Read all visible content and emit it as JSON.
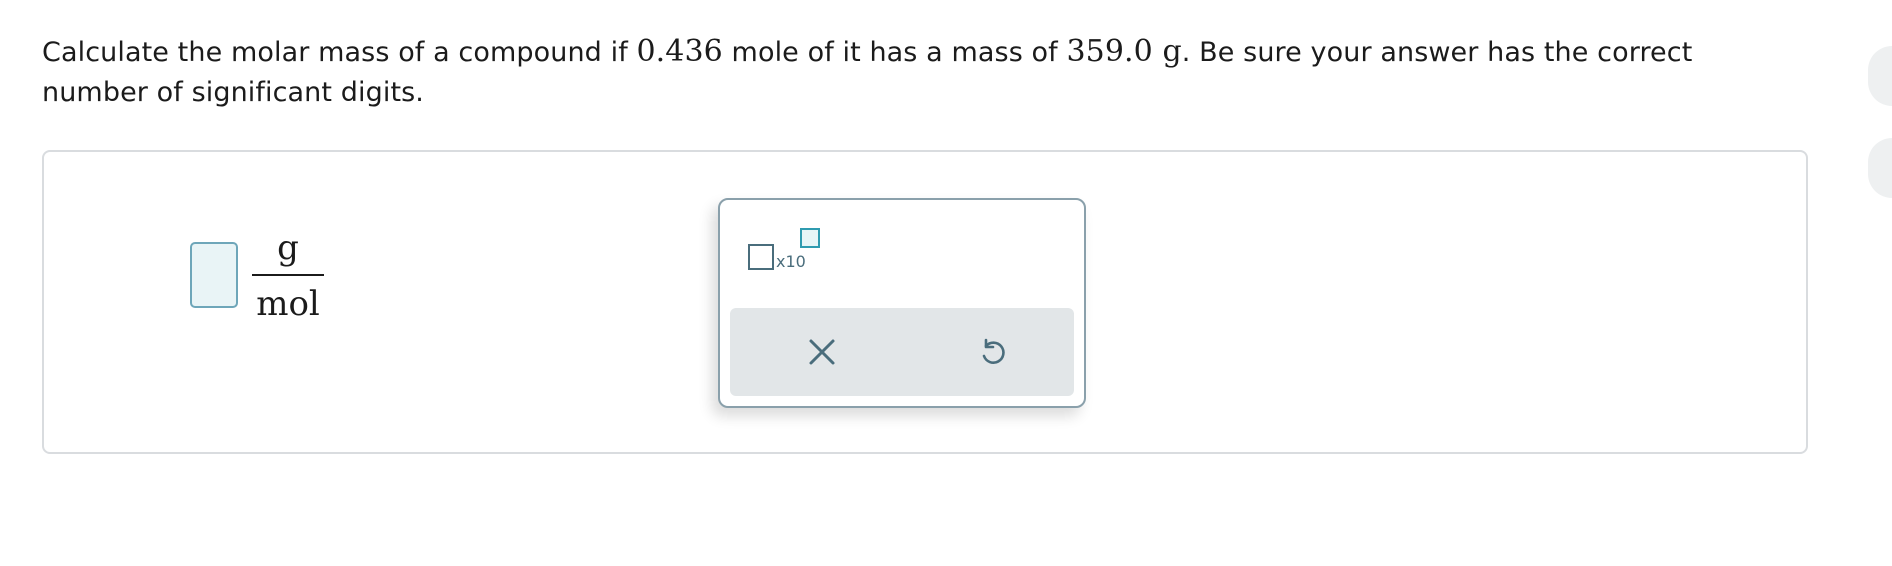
{
  "question": {
    "part1": "Calculate the molar mass of a compound if ",
    "moles": "0.436",
    "part2": " mole of it has a mass of ",
    "mass": "359.0 g",
    "part3": ". Be sure your answer has the correct number of significant digits."
  },
  "answer": {
    "value": "",
    "unit_numerator": "g",
    "unit_denominator": "mol"
  },
  "toolbox": {
    "sci_notation_label": "x10",
    "clear_icon": "close-icon",
    "undo_icon": "undo-icon"
  },
  "colors": {
    "input_border": "#6ea6b9",
    "input_fill": "#e9f4f6",
    "icon": "#4a6d7c",
    "exponent_accent": "#2f9bb0",
    "action_bar": "#e2e6e8"
  }
}
